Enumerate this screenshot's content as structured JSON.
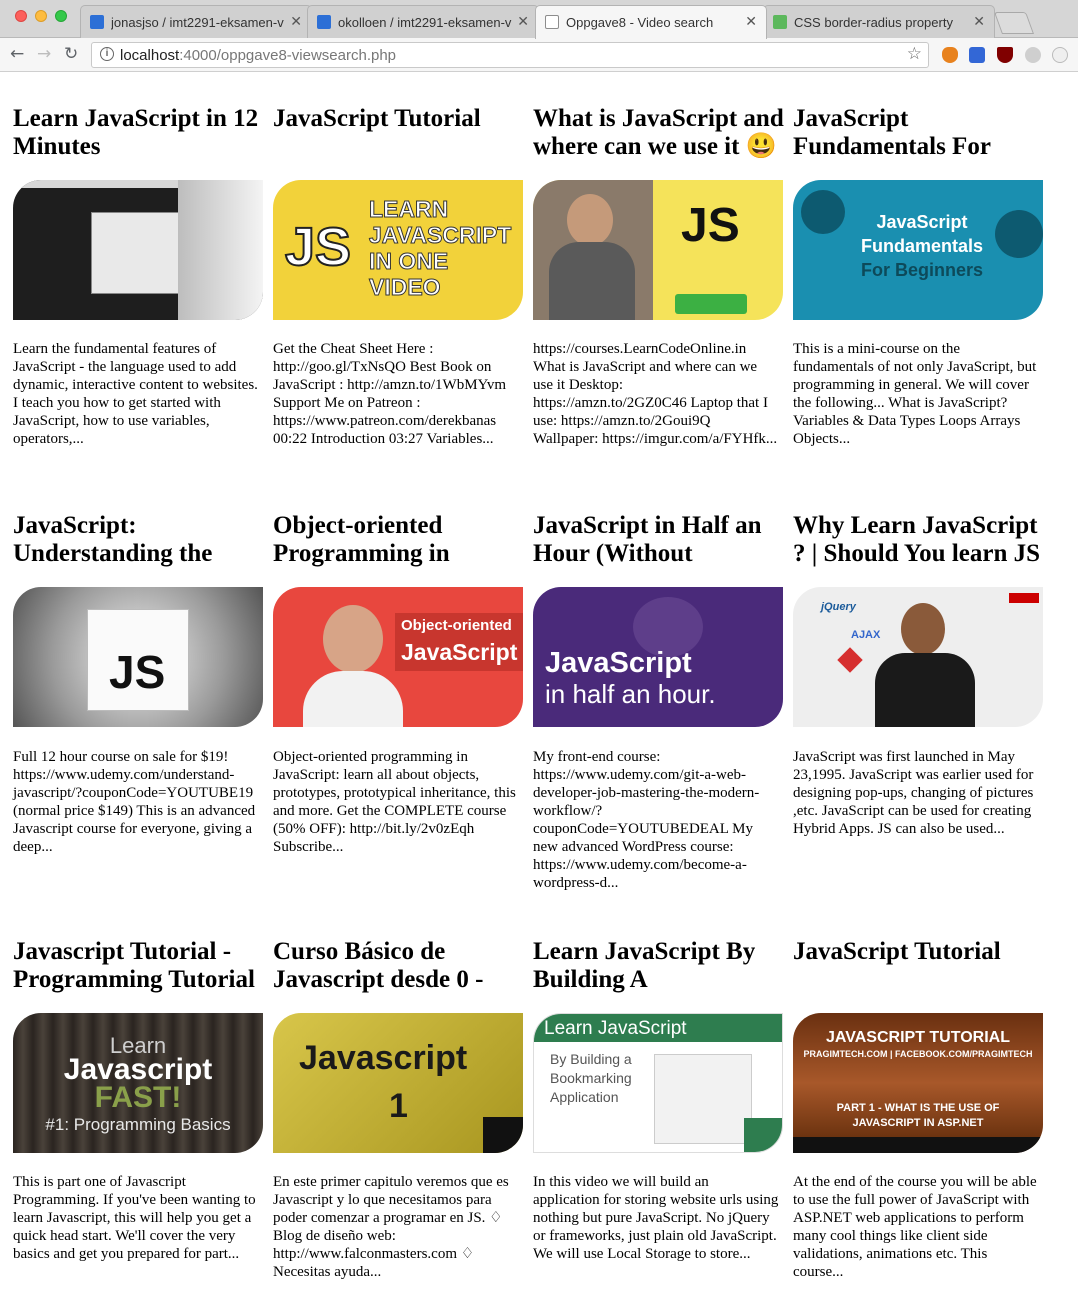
{
  "browser": {
    "tabs": [
      {
        "title": "jonasjso / imt2291-eksamen-v",
        "favicon": "bitbucket-icon"
      },
      {
        "title": "okolloen / imt2291-eksamen-v",
        "favicon": "bitbucket-icon"
      },
      {
        "title": "Oppgave8 - Video search",
        "favicon": "page-icon"
      },
      {
        "title": "CSS border-radius property",
        "favicon": "w3schools-icon"
      }
    ],
    "url_host": "localhost",
    "url_rest": ":4000/oppgave8-viewsearch.php"
  },
  "videos": [
    {
      "title": "Learn JavaScript in 12 Minutes",
      "description": "Learn the fundamental features of JavaScript - the language used to add dynamic, interactive content to websites. I teach you how to get started with JavaScript, how to use variables, operators,...",
      "thumb_text": "",
      "thumb_bg": "#1e1e1e"
    },
    {
      "title": "JavaScript Tutorial",
      "description": "Get the Cheat Sheet Here : http://goo.gl/TxNsQO Best Book on JavaScript : http://amzn.to/1WbMYvm Support Me on Patreon : https://www.patreon.com/derekbanas 00:22 Introduction 03:27 Variables...",
      "thumb_text": "LEARN JAVASCRIPT IN ONE VIDEO",
      "thumb_bg": "#f2d23a"
    },
    {
      "title": "What is JavaScript and where can we use it 😃",
      "description": "https://courses.LearnCodeOnline.in What is JavaScript and where can we use it Desktop: https://amzn.to/2GZ0C46 Laptop that I use: https://amzn.to/2Goui9Q Wallpaper: https://imgur.com/a/FYHfk...",
      "thumb_text": "JS",
      "thumb_bg": "#f5e35a"
    },
    {
      "title": "JavaScript Fundamentals For",
      "description": "This is a mini-course on the fundamentals of not only JavaScript, but programming in general. We will cover the following... What is JavaScript? Variables & Data Types Loops Arrays Objects...",
      "thumb_text": "JavaScript Fundamentals For Beginners",
      "thumb_bg": "#1a8fb0"
    },
    {
      "title": "JavaScript: Understanding the",
      "description": "Full 12 hour course on sale for $19! https://www.udemy.com/understand-javascript/?couponCode=YOUTUBE19 (normal price $149) This is an advanced Javascript course for everyone, giving a deep...",
      "thumb_text": "JS",
      "thumb_bg": "#8a8a8a"
    },
    {
      "title": "Object-oriented Programming in",
      "description": "Object-oriented programming in JavaScript: learn all about objects, prototypes, prototypical inheritance, this and more. Get the COMPLETE course (50% OFF): http://bit.ly/2v0zEqh Subscribe...",
      "thumb_text": "Object-oriented JavaScript",
      "thumb_bg": "#e8473e"
    },
    {
      "title": "JavaScript in Half an Hour (Without jQuery!)",
      "description": "My front-end course: https://www.udemy.com/git-a-web-developer-job-mastering-the-modern-workflow/?couponCode=YOUTUBEDEAL My new advanced WordPress course: https://www.udemy.com/become-a-wordpress-d...",
      "thumb_text": "JavaScript in half an hour.",
      "thumb_bg": "#4a2a7a"
    },
    {
      "title": "Why Learn JavaScript ? | Should You learn JS",
      "description": "JavaScript was first launched in May 23,1995. JavaScript was earlier used for designing pop-ups, changing of pictures ,etc. JavaScript can be used for creating Hybrid Apps. JS can also be used...",
      "thumb_text": "jQuery",
      "thumb_bg": "#eeeeee"
    },
    {
      "title": "Javascript Tutorial - Programming Tutorial",
      "description": "This is part one of Javascript Programming. If you've been wanting to learn Javascript, this will help you get a quick head start. We'll cover the very basics and get you prepared for part...",
      "thumb_text": "Learn Javascript FAST! #1: Programming Basics",
      "thumb_bg": "#3a3430"
    },
    {
      "title": "Curso Básico de Javascript desde 0 -",
      "description": "En este primer capitulo veremos que es Javascript y lo que necesitamos para poder comenzar a programar en JS. ♢ Blog de diseño web: http://www.falconmasters.com ♢ Necesitas ayuda...",
      "thumb_text": "Javascript 1",
      "thumb_bg": "#c9b52a"
    },
    {
      "title": "Learn JavaScript By Building A Bookmarker",
      "description": "In this video we will build an application for storing website urls using nothing but pure JavaScript. No jQuery or frameworks, just plain old JavaScript. We will use Local Storage to store...",
      "thumb_text": "Learn JavaScript By Building a Bookmarking Application",
      "thumb_bg": "#ffffff"
    },
    {
      "title": "JavaScript Tutorial",
      "description": "At the end of the course you will be able to use the full power of JavaScript with ASP.NET web applications to perform many cool things like client side validations, animations etc. This course...",
      "thumb_text": "JAVASCRIPT TUTORIAL",
      "thumb_bg": "#7a3a10"
    }
  ]
}
